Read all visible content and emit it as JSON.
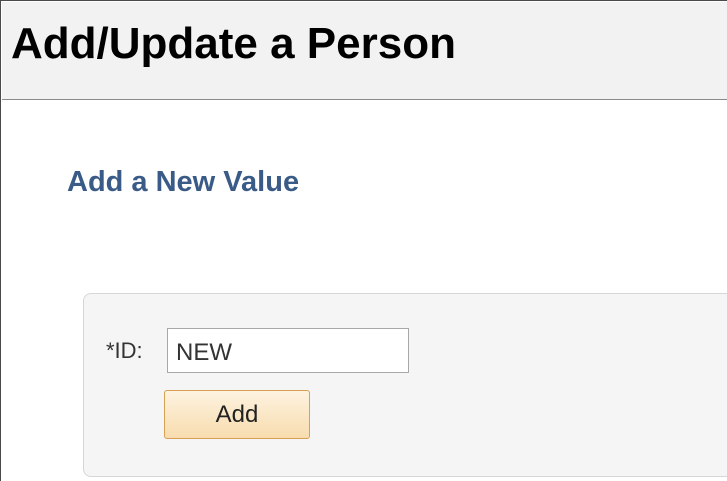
{
  "header": {
    "title": "Add/Update a Person"
  },
  "main": {
    "section_title": "Add a New Value",
    "form": {
      "id_label": "*ID:",
      "id_value": "NEW",
      "add_button_label": "Add"
    }
  },
  "colors": {
    "section_title": "#3a5b88",
    "header_background": "#f2f2f2",
    "button_background": "#f8dcae",
    "button_border": "#d6a055"
  }
}
